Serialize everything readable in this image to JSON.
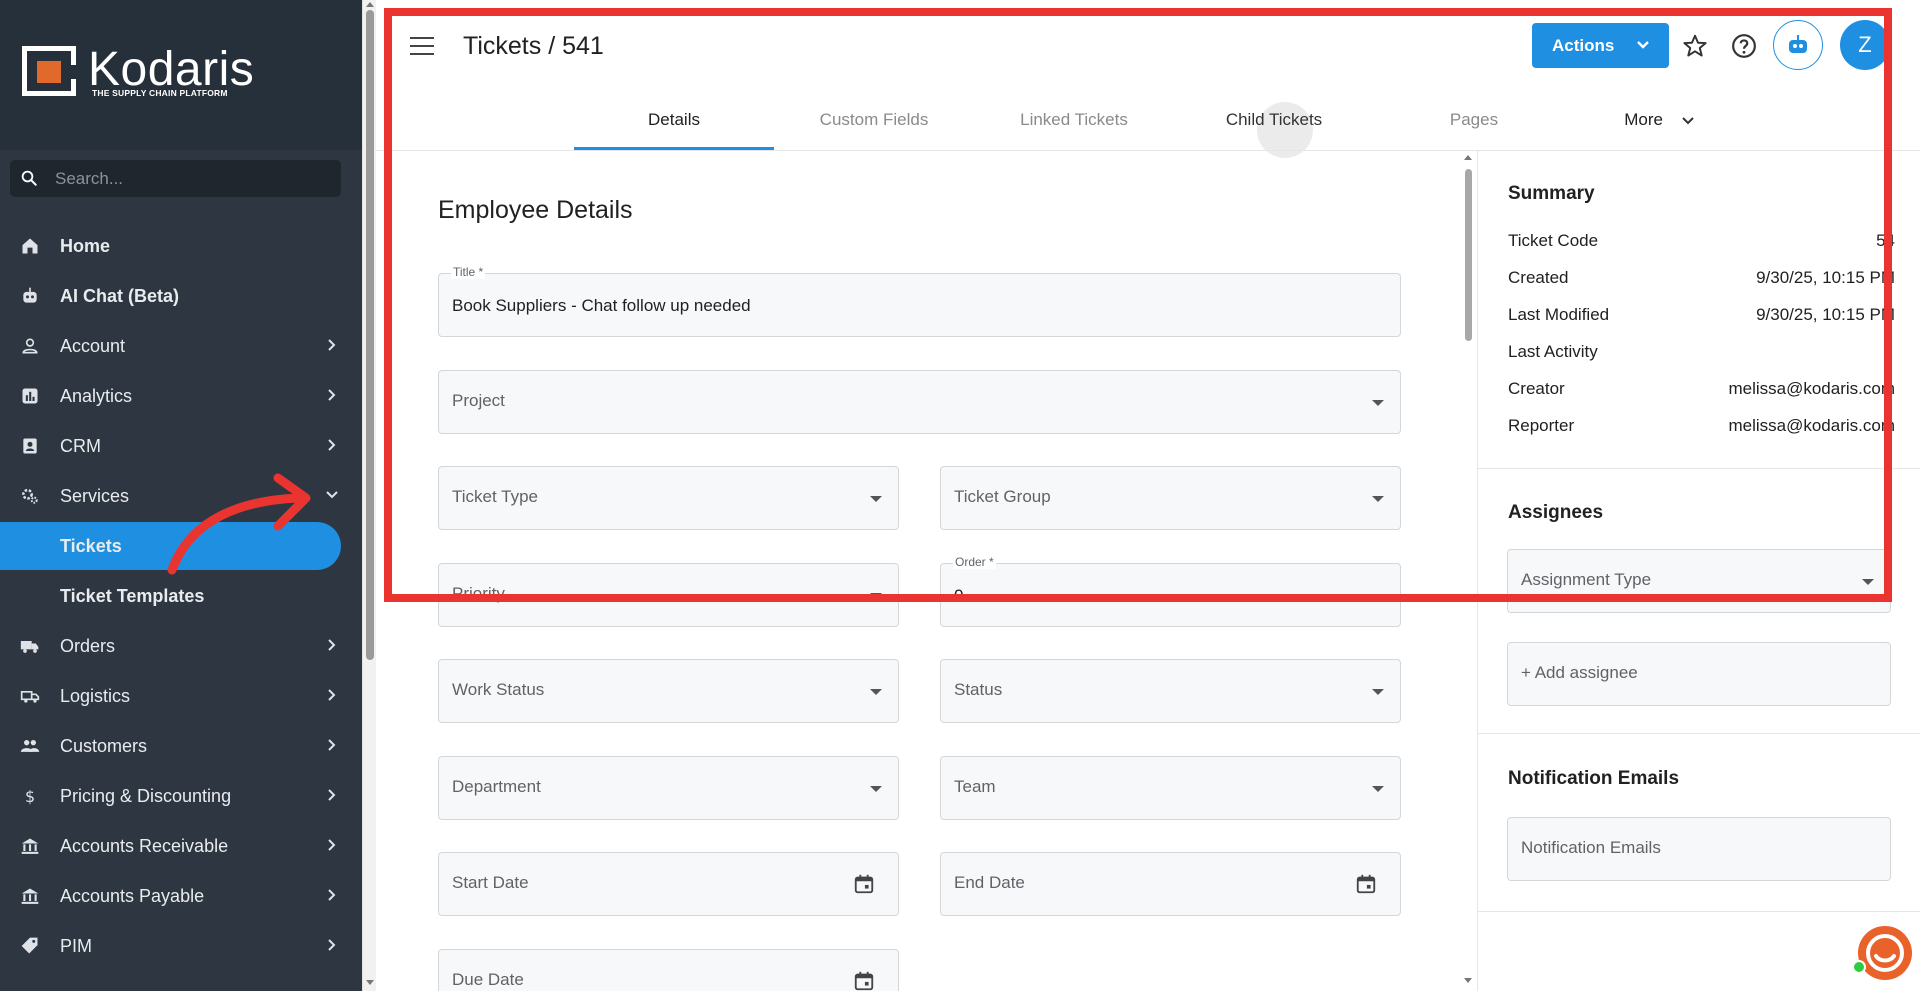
{
  "app": {
    "brand": "Kodaris",
    "tagline": "THE SUPPLY CHAIN PLATFORM",
    "accent_color": "#1e8fe1",
    "logo_color": "#e0692b",
    "annotation_color": "#ea3430"
  },
  "sidebar": {
    "search_placeholder": "Search...",
    "items": [
      {
        "label": "Home",
        "icon": "home-icon",
        "chevron": false
      },
      {
        "label": "AI Chat (Beta)",
        "icon": "robot-icon",
        "chevron": false
      },
      {
        "label": "Account",
        "icon": "person-icon",
        "chevron": true
      },
      {
        "label": "Analytics",
        "icon": "analytics-icon",
        "chevron": true
      },
      {
        "label": "CRM",
        "icon": "contacts-icon",
        "chevron": true
      },
      {
        "label": "Services",
        "icon": "settings-icon",
        "chevron": "down"
      },
      {
        "label": "Tickets",
        "icon": "",
        "active": true
      },
      {
        "label": "Ticket Templates",
        "icon": ""
      },
      {
        "label": "Orders",
        "icon": "truck-icon",
        "chevron": true
      },
      {
        "label": "Logistics",
        "icon": "shipping-icon",
        "chevron": true
      },
      {
        "label": "Customers",
        "icon": "people-icon",
        "chevron": true
      },
      {
        "label": "Pricing & Discounting",
        "icon": "dollar-icon",
        "chevron": true
      },
      {
        "label": "Accounts Receivable",
        "icon": "bank-icon",
        "chevron": true
      },
      {
        "label": "Accounts Payable",
        "icon": "bank-icon",
        "chevron": true
      },
      {
        "label": "PIM",
        "icon": "tag-icon",
        "chevron": true
      }
    ]
  },
  "header": {
    "title": "Tickets / 541",
    "actions_label": "Actions",
    "avatar_initial": "Z"
  },
  "tabs": [
    {
      "label": "Details",
      "active": true
    },
    {
      "label": "Custom Fields"
    },
    {
      "label": "Linked Tickets"
    },
    {
      "label": "Child Tickets"
    },
    {
      "label": "Pages"
    },
    {
      "label": "More"
    }
  ],
  "form": {
    "section_title": "Employee Details",
    "title_label": "Title *",
    "title_value": "Book Suppliers - Chat follow up needed",
    "project": "Project",
    "ticket_type": "Ticket Type",
    "ticket_group": "Ticket Group",
    "priority": "Priority",
    "order_label": "Order *",
    "order_value": "0",
    "work_status": "Work Status",
    "status": "Status",
    "department": "Department",
    "team": "Team",
    "start_date": "Start Date",
    "end_date": "End Date",
    "due_date": "Due Date"
  },
  "summary": {
    "title": "Summary",
    "rows": [
      {
        "key": "Ticket Code",
        "value": "54"
      },
      {
        "key": "Created",
        "value": "9/30/25, 10:15 PM"
      },
      {
        "key": "Last Modified",
        "value": "9/30/25, 10:15 PM"
      },
      {
        "key": "Last Activity",
        "value": ""
      },
      {
        "key": "Creator",
        "value": "melissa@kodaris.com"
      },
      {
        "key": "Reporter",
        "value": "melissa@kodaris.com"
      }
    ]
  },
  "assignees": {
    "title": "Assignees",
    "assignment_type": "Assignment Type",
    "add_label": "+ Add assignee"
  },
  "notifications": {
    "title": "Notification Emails",
    "placeholder": "Notification Emails"
  }
}
